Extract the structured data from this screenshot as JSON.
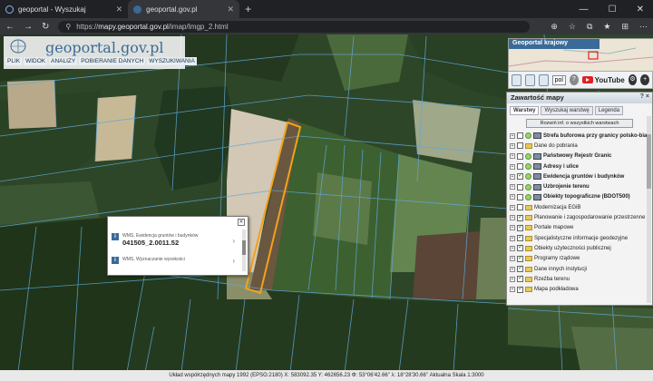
{
  "browser": {
    "tabs": [
      {
        "title": "geoportal - Wyszukaj",
        "active": false
      },
      {
        "title": "geoportal.gov.pl",
        "active": true
      }
    ],
    "url_prefix": "https://",
    "url_host": "mapy.geoportal.gov.pl",
    "url_path": "/imap/Imgp_2.html"
  },
  "logo": {
    "text": "geoportal.gov.pl"
  },
  "menu": [
    "PLIK",
    "WIDOK",
    "ANALIZY",
    "POBIERANIE DANYCH",
    "WYSZUKIWANIA"
  ],
  "geoportal_krajowy": {
    "title": "Geoportal krajowy"
  },
  "toolbar": {
    "language": "pol",
    "youtube_label": "YouTube"
  },
  "panel": {
    "title": "Zawartość mapy",
    "header_icons": "? ×",
    "tabs": [
      "Warstwy",
      "Wyszukaj warstwę",
      "Legenda"
    ],
    "expand_button": "Rozwiń inf. o wszystkich warstwach",
    "layers": [
      {
        "label": "Strefa buforowa przy granicy polsko-białoruskiej",
        "type": "wms",
        "bold": true,
        "checked": false
      },
      {
        "label": "Dane do pobrania",
        "type": "folder",
        "bold": false,
        "checked": false
      },
      {
        "label": "Państwowy Rejestr Granic",
        "type": "wms",
        "bold": true,
        "checked": false
      },
      {
        "label": "Adresy i ulice",
        "type": "wms",
        "bold": true,
        "checked": false
      },
      {
        "label": "Ewidencja gruntów i budynków",
        "type": "wms",
        "bold": true,
        "checked": true
      },
      {
        "label": "Uzbrojenie terenu",
        "type": "wms",
        "bold": true,
        "checked": false
      },
      {
        "label": "Obiekty topograficzne (BDOT500)",
        "type": "wms",
        "bold": true,
        "checked": false
      },
      {
        "label": "Modernizacja EGiB",
        "type": "folder",
        "bold": false,
        "checked": false
      },
      {
        "label": "Planowanie i zagospodarowanie przestrzenne",
        "type": "folder",
        "bold": false,
        "checked": true
      },
      {
        "label": "Portale mapowe",
        "type": "folder",
        "bold": false,
        "checked": true
      },
      {
        "label": "Specjalistyczne informacje geodezyjne",
        "type": "folder",
        "bold": false,
        "checked": true
      },
      {
        "label": "Obiekty użyteczności publicznej",
        "type": "folder",
        "bold": false,
        "checked": true
      },
      {
        "label": "Programy rządowe",
        "type": "folder",
        "bold": false,
        "checked": true
      },
      {
        "label": "Dane innych instytucji",
        "type": "folder",
        "bold": false,
        "checked": true
      },
      {
        "label": "Rzeźba terenu",
        "type": "folder",
        "bold": false,
        "checked": true
      },
      {
        "label": "Mapa podkładowa",
        "type": "folder",
        "bold": false,
        "checked": true
      }
    ]
  },
  "popup": {
    "row1_small": "WMS, Ewidencja gruntów i budynków",
    "row1_value": "041505_2.0011.52",
    "row2_small": "WMS, Wyznaczanie wysokości"
  },
  "statusbar": {
    "text": "Układ współrzędnych mapy 1992 (EPSG:2180)   X: 583092.35  Y: 462656.23   Φ: 53°06'42.66\"  λ: 18°28'30.66\"   Aktualna Skala 1:3000"
  },
  "colors": {
    "parcel_outline": "#f2a21a",
    "panel_header": "#cdd6df",
    "logo_blue": "#3a6a98"
  }
}
